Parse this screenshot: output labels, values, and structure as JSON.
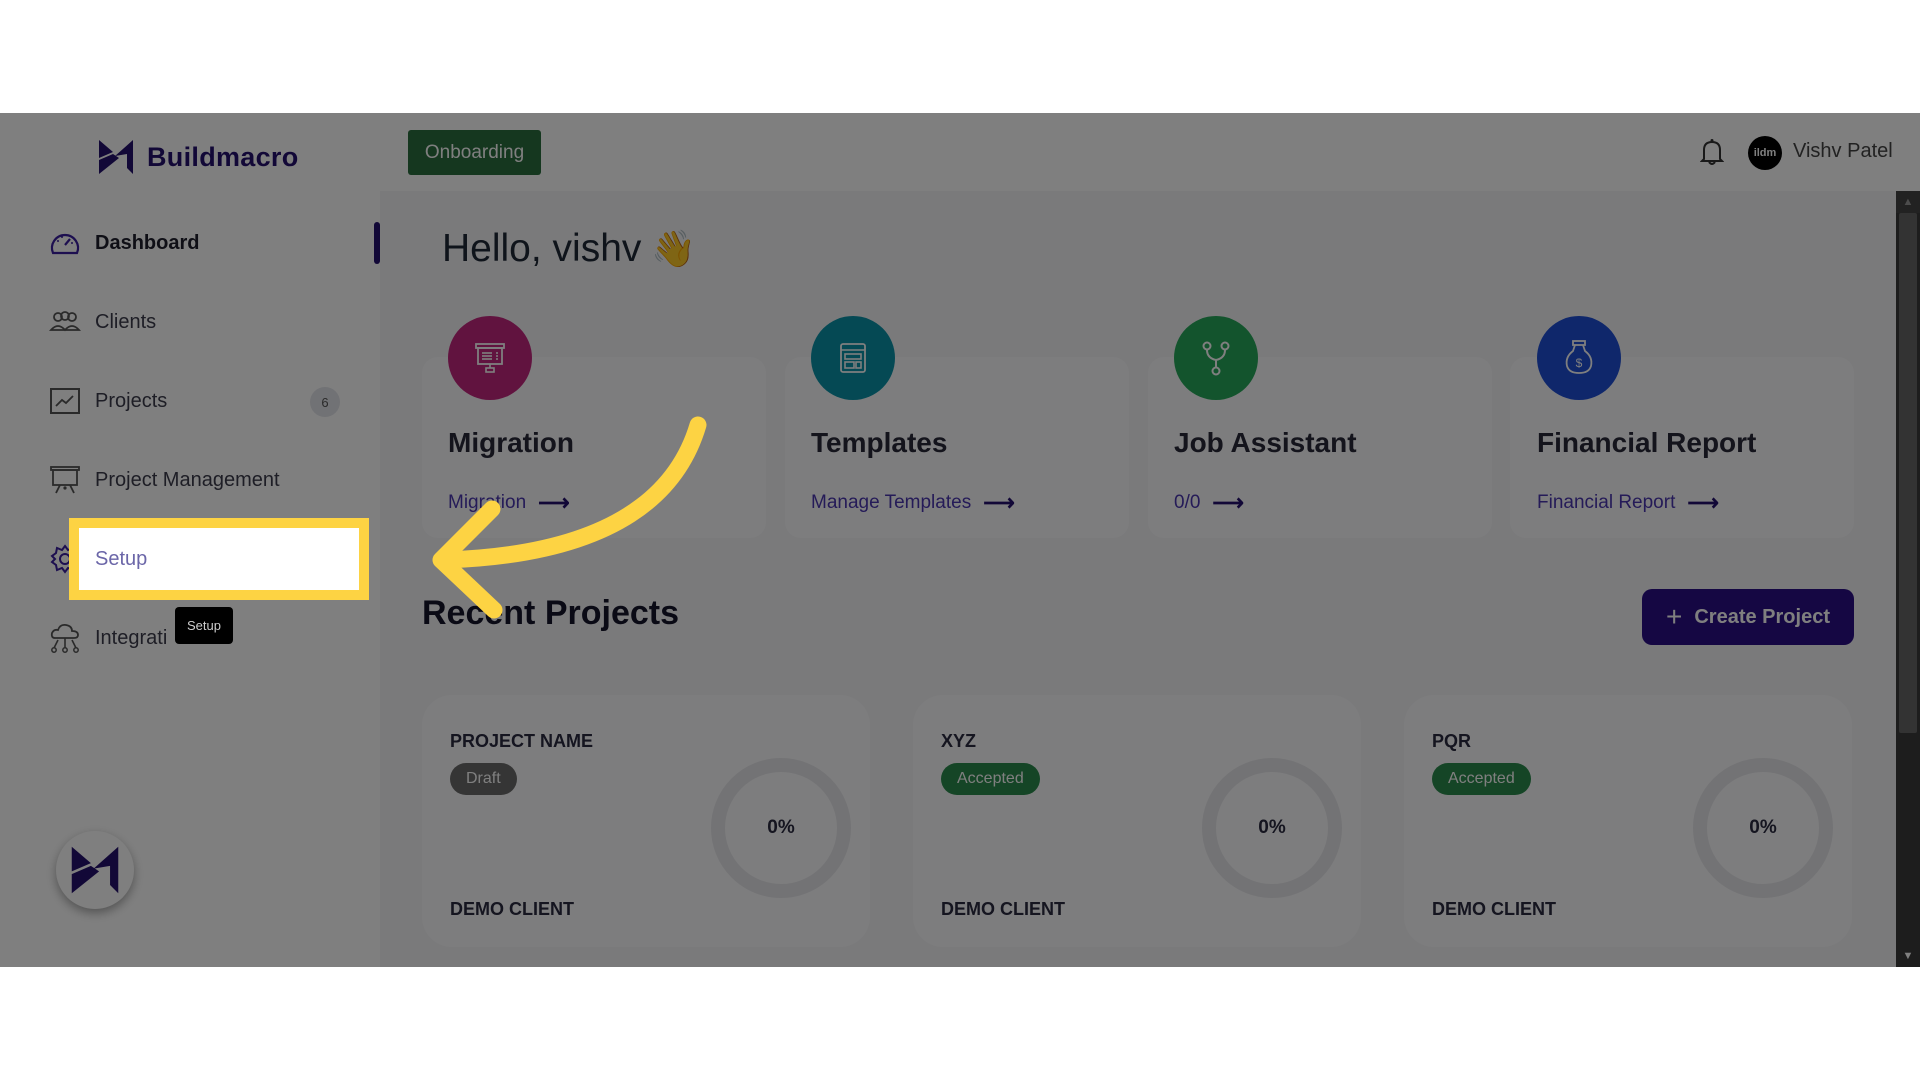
{
  "brand": {
    "name": "Buildmacro"
  },
  "sidebar": {
    "items": [
      {
        "label": "Dashboard",
        "icon": "dashboard-gauge-icon",
        "active": true
      },
      {
        "label": "Clients",
        "icon": "clients-group-icon"
      },
      {
        "label": "Projects",
        "icon": "projects-chart-icon",
        "badge": "6"
      },
      {
        "label": "Project Management",
        "icon": "presentation-board-icon"
      },
      {
        "label": "Setup",
        "icon": "gear-icon"
      },
      {
        "label": "Integrations",
        "icon": "cloud-network-icon",
        "visible_text": "Integrati"
      }
    ],
    "collapse_icon": "chevron-left-icon"
  },
  "header": {
    "onboarding_label": "Onboarding",
    "notification_icon": "bell-icon",
    "avatar_text": "ildm",
    "user_name": "Vishv Patel"
  },
  "main": {
    "greeting": "Hello, vishv",
    "greeting_emoji": "👋",
    "features": [
      {
        "title": "Migration",
        "link": "Migration",
        "icon": "presentation-icon",
        "color": "#c3277f"
      },
      {
        "title": "Templates",
        "link": "Manage Templates",
        "icon": "template-layout-icon",
        "color": "#0b93a9"
      },
      {
        "title": "Job Assistant",
        "link": "0/0",
        "icon": "fork-icon",
        "color": "#27a85a"
      },
      {
        "title": "Financial Report",
        "link": "Financial Report",
        "icon": "money-bag-icon",
        "color": "#1e4fd6"
      }
    ],
    "link_arrow": "⟶",
    "recent_projects_title": "Recent Projects",
    "create_project_label": "Create Project",
    "create_project_icon": "+",
    "projects": [
      {
        "name": "PROJECT NAME",
        "status": "Draft",
        "status_color": "#6b6b6b",
        "client": "DEMO CLIENT",
        "progress": "0%",
        "progress_value": 0
      },
      {
        "name": "XYZ",
        "status": "Accepted",
        "status_color": "#2b8a4c",
        "client": "DEMO CLIENT",
        "progress": "0%",
        "progress_value": 0
      },
      {
        "name": "PQR",
        "status": "Accepted",
        "status_color": "#2b8a4c",
        "client": "DEMO CLIENT",
        "progress": "0%",
        "progress_value": 0
      }
    ]
  },
  "annotation": {
    "highlight_label": "Setup",
    "tooltip": "Setup",
    "highlight_color": "#fdd343"
  },
  "colors": {
    "brand": "#24106e",
    "onboarding": "#2b6e3e",
    "create_button": "#2a0f86"
  }
}
